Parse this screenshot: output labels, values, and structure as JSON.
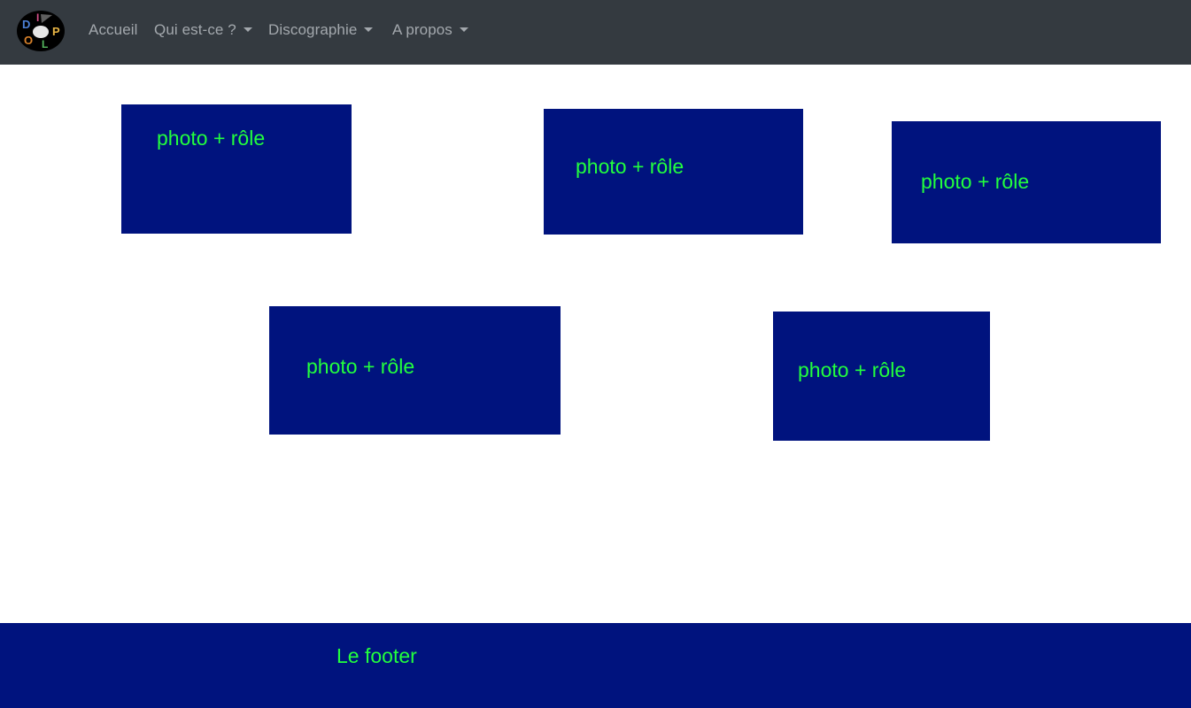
{
  "nav": {
    "logo_letters": [
      "D",
      "I",
      "P",
      "L",
      "O"
    ],
    "items": [
      {
        "label": "Accueil"
      },
      {
        "label": "Qui est-ce ?"
      },
      {
        "label": "Discographie"
      },
      {
        "label": "A propos"
      }
    ]
  },
  "cards": [
    {
      "label": "photo + rôle"
    },
    {
      "label": "photo + rôle"
    },
    {
      "label": "photo + rôle"
    },
    {
      "label": "photo + rôle"
    },
    {
      "label": "photo + rôle"
    }
  ],
  "footer": {
    "label": "Le footer"
  },
  "colors": {
    "navbar": "#343a40",
    "card_background": "#00137e",
    "accent_text": "#22ff3d",
    "nav_text": "#a3a8ad"
  }
}
